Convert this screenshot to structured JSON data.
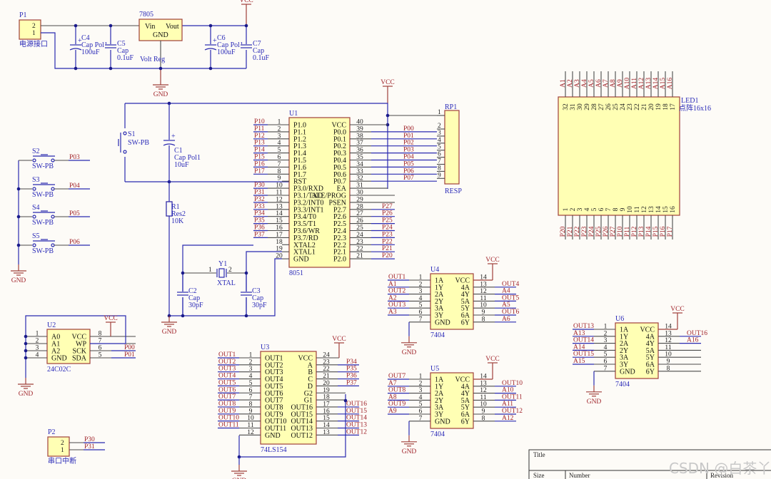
{
  "power": {
    "vcc": "VCC",
    "gnd": "GND"
  },
  "p1": {
    "ref": "P1",
    "desc": "电源接口",
    "pins": [
      "2",
      "1"
    ]
  },
  "p2": {
    "ref": "P2",
    "desc": "串口中断",
    "pins": [
      "2",
      "1"
    ],
    "nets": [
      "P30",
      "P31"
    ]
  },
  "reg": {
    "part": "7805",
    "vin": "Vin",
    "vout": "Vout",
    "gnd": "GND",
    "footer": "Volt Reg"
  },
  "passives": {
    "c4": {
      "ref": "C4",
      "type": "Cap Pol1",
      "value": "100uF"
    },
    "c5": {
      "ref": "C5",
      "type": "Cap",
      "value": "0.1uF"
    },
    "c6": {
      "ref": "C6",
      "type": "Cap Pol1",
      "value": "100uF"
    },
    "c7": {
      "ref": "C7",
      "type": "Cap",
      "value": "0.1uF"
    },
    "c1": {
      "ref": "C1",
      "type": "Cap Pol1",
      "value": "10uF"
    },
    "c2": {
      "ref": "C2",
      "type": "Cap",
      "value": "30pF"
    },
    "c3": {
      "ref": "C3",
      "type": "Cap",
      "value": "30pF"
    },
    "r1": {
      "ref": "R1",
      "type": "Res2",
      "value": "10K"
    },
    "y1": {
      "ref": "Y1",
      "type": "XTAL",
      "pin1": "1",
      "pin2": "2"
    }
  },
  "switches": [
    {
      "ref": "S1",
      "type": "SW-PB",
      "net": ""
    },
    {
      "ref": "S2",
      "type": "SW-PB",
      "net": "P03"
    },
    {
      "ref": "S3",
      "type": "SW-PB",
      "net": "P04"
    },
    {
      "ref": "S4",
      "type": "SW-PB",
      "net": "P05"
    },
    {
      "ref": "S5",
      "type": "SW-PB",
      "net": "P06"
    }
  ],
  "u1": {
    "ref": "U1",
    "part": "8051",
    "left": [
      {
        "n": "1",
        "name": "P1.0",
        "net": "P10"
      },
      {
        "n": "2",
        "name": "P1.1",
        "net": "P11"
      },
      {
        "n": "3",
        "name": "P1.2",
        "net": "P12"
      },
      {
        "n": "4",
        "name": "P1.3",
        "net": "P13"
      },
      {
        "n": "5",
        "name": "P1.4",
        "net": "P14"
      },
      {
        "n": "6",
        "name": "P1.5",
        "net": "P15"
      },
      {
        "n": "7",
        "name": "P1.6",
        "net": "P16"
      },
      {
        "n": "8",
        "name": "P1.7",
        "net": "P17"
      },
      {
        "n": "9",
        "name": "RST",
        "net": ""
      },
      {
        "n": "10",
        "name": "P3.0/RXD",
        "net": "P30"
      },
      {
        "n": "11",
        "name": "P3.1/TXD",
        "net": "P31"
      },
      {
        "n": "12",
        "name": "P3.2/INT0",
        "net": "P32"
      },
      {
        "n": "13",
        "name": "P3.3/INT1",
        "net": "P33"
      },
      {
        "n": "14",
        "name": "P3.4/T0",
        "net": "P34"
      },
      {
        "n": "15",
        "name": "P3.5/T1",
        "net": "P35"
      },
      {
        "n": "16",
        "name": "P3.6/WR",
        "net": "P36"
      },
      {
        "n": "17",
        "name": "P3.7/RD",
        "net": "P37"
      },
      {
        "n": "18",
        "name": "XTAL2",
        "net": ""
      },
      {
        "n": "19",
        "name": "XTAL1",
        "net": ""
      },
      {
        "n": "20",
        "name": "GND",
        "net": ""
      }
    ],
    "right": [
      {
        "n": "40",
        "name": "VCC",
        "net": ""
      },
      {
        "n": "39",
        "name": "P0.0",
        "net": "P00"
      },
      {
        "n": "38",
        "name": "P0.1",
        "net": "P01"
      },
      {
        "n": "37",
        "name": "P0.2",
        "net": "P02"
      },
      {
        "n": "36",
        "name": "P0.3",
        "net": "P03"
      },
      {
        "n": "35",
        "name": "P0.4",
        "net": "P04"
      },
      {
        "n": "34",
        "name": "P0.5",
        "net": "P05"
      },
      {
        "n": "33",
        "name": "P0.6",
        "net": "P06"
      },
      {
        "n": "32",
        "name": "P0.7",
        "net": "P07"
      },
      {
        "n": "31",
        "name": "EA",
        "net": ""
      },
      {
        "n": "30",
        "name": "ALE/PROG",
        "net": ""
      },
      {
        "n": "29",
        "name": "PSEN",
        "net": ""
      },
      {
        "n": "28",
        "name": "P2.7",
        "net": "P27"
      },
      {
        "n": "27",
        "name": "P2.6",
        "net": "P26"
      },
      {
        "n": "26",
        "name": "P2.5",
        "net": "P25"
      },
      {
        "n": "25",
        "name": "P2.4",
        "net": "P24"
      },
      {
        "n": "24",
        "name": "P2.3",
        "net": "P23"
      },
      {
        "n": "23",
        "name": "P2.2",
        "net": "P22"
      },
      {
        "n": "22",
        "name": "P2.1",
        "net": "P21"
      },
      {
        "n": "21",
        "name": "P2.0",
        "net": "P20"
      }
    ]
  },
  "rp1": {
    "ref": "RP1",
    "part": "RESP",
    "pins": [
      "1",
      "2",
      "3",
      "4",
      "5",
      "6",
      "7",
      "8",
      "9"
    ]
  },
  "u2": {
    "ref": "U2",
    "part": "24C02C",
    "left": [
      {
        "n": "1",
        "name": "A0",
        "net": ""
      },
      {
        "n": "2",
        "name": "A1",
        "net": ""
      },
      {
        "n": "3",
        "name": "A2",
        "net": ""
      },
      {
        "n": "4",
        "name": "GND",
        "net": ""
      }
    ],
    "right": [
      {
        "n": "8",
        "name": "VCC",
        "net": ""
      },
      {
        "n": "7",
        "name": "WP",
        "net": ""
      },
      {
        "n": "6",
        "name": "SCK",
        "net": "P00"
      },
      {
        "n": "5",
        "name": "SDA",
        "net": "P01"
      }
    ]
  },
  "u3": {
    "ref": "U3",
    "part": "74LS154",
    "left": [
      {
        "n": "1",
        "name": "OUT1",
        "net": "OUT1"
      },
      {
        "n": "2",
        "name": "OUT2",
        "net": "OUT2"
      },
      {
        "n": "3",
        "name": "OUT3",
        "net": "OUT3"
      },
      {
        "n": "4",
        "name": "OUT4",
        "net": "OUT4"
      },
      {
        "n": "5",
        "name": "OUT5",
        "net": "OUT5"
      },
      {
        "n": "6",
        "name": "OUT6",
        "net": "OUT6"
      },
      {
        "n": "7",
        "name": "OUT7",
        "net": "OUT7"
      },
      {
        "n": "8",
        "name": "OUT8",
        "net": "OUT8"
      },
      {
        "n": "9",
        "name": "OUT9",
        "net": "OUT9"
      },
      {
        "n": "10",
        "name": "OUT10",
        "net": "OUT10"
      },
      {
        "n": "11",
        "name": "OUT11",
        "net": "OUT11"
      },
      {
        "n": "12",
        "name": "GND",
        "net": ""
      }
    ],
    "right": [
      {
        "n": "24",
        "name": "VCC",
        "net": ""
      },
      {
        "n": "23",
        "name": "A",
        "net": "P34"
      },
      {
        "n": "22",
        "name": "B",
        "net": "P35"
      },
      {
        "n": "21",
        "name": "C",
        "net": "P36"
      },
      {
        "n": "20",
        "name": "D",
        "net": "P37"
      },
      {
        "n": "19",
        "name": "G2",
        "net": ""
      },
      {
        "n": "18",
        "name": "G1",
        "net": ""
      },
      {
        "n": "17",
        "name": "OUT16",
        "net": "OUT16"
      },
      {
        "n": "16",
        "name": "OUT15",
        "net": "OUT15"
      },
      {
        "n": "15",
        "name": "OUT14",
        "net": "OUT14"
      },
      {
        "n": "14",
        "name": "OUT13",
        "net": "OUT13"
      },
      {
        "n": "13",
        "name": "OUT12",
        "net": "OUT12"
      }
    ]
  },
  "u4": {
    "ref": "U4",
    "part": "7404",
    "left": [
      {
        "n": "1",
        "name": "1A",
        "net": "OUT1"
      },
      {
        "n": "2",
        "name": "1Y",
        "net": "A1"
      },
      {
        "n": "3",
        "name": "2A",
        "net": "OUT2"
      },
      {
        "n": "4",
        "name": "2Y",
        "net": "A2"
      },
      {
        "n": "5",
        "name": "3A",
        "net": "OUT3"
      },
      {
        "n": "6",
        "name": "3Y",
        "net": "A3"
      },
      {
        "n": "7",
        "name": "GND",
        "net": ""
      }
    ],
    "right": [
      {
        "n": "14",
        "name": "VCC",
        "net": ""
      },
      {
        "n": "13",
        "name": "4A",
        "net": "OUT4"
      },
      {
        "n": "12",
        "name": "4Y",
        "net": "A4"
      },
      {
        "n": "11",
        "name": "5A",
        "net": "OUT5"
      },
      {
        "n": "10",
        "name": "5Y",
        "net": "A5"
      },
      {
        "n": "9",
        "name": "6A",
        "net": "OUT6"
      },
      {
        "n": "8",
        "name": "6Y",
        "net": "A6"
      }
    ]
  },
  "u5": {
    "ref": "U5",
    "part": "7404",
    "left": [
      {
        "n": "1",
        "name": "1A",
        "net": "OUT7"
      },
      {
        "n": "2",
        "name": "1Y",
        "net": "A7"
      },
      {
        "n": "3",
        "name": "2A",
        "net": "OUT8"
      },
      {
        "n": "4",
        "name": "2Y",
        "net": "A8"
      },
      {
        "n": "5",
        "name": "3A",
        "net": "OUT9"
      },
      {
        "n": "6",
        "name": "3Y",
        "net": "A9"
      },
      {
        "n": "7",
        "name": "GND",
        "net": ""
      }
    ],
    "right": [
      {
        "n": "14",
        "name": "VCC",
        "net": ""
      },
      {
        "n": "13",
        "name": "4A",
        "net": "OUT10"
      },
      {
        "n": "12",
        "name": "4Y",
        "net": "A10"
      },
      {
        "n": "11",
        "name": "5A",
        "net": "OUT11"
      },
      {
        "n": "10",
        "name": "5Y",
        "net": "A11"
      },
      {
        "n": "9",
        "name": "6A",
        "net": "OUT12"
      },
      {
        "n": "8",
        "name": "6Y",
        "net": "A12"
      }
    ]
  },
  "u6": {
    "ref": "U6",
    "part": "7404",
    "left": [
      {
        "n": "1",
        "name": "1A",
        "net": "OUT13"
      },
      {
        "n": "2",
        "name": "1Y",
        "net": "A13"
      },
      {
        "n": "3",
        "name": "2A",
        "net": "OUT14"
      },
      {
        "n": "4",
        "name": "2Y",
        "net": "A14"
      },
      {
        "n": "5",
        "name": "3A",
        "net": "OUT15"
      },
      {
        "n": "6",
        "name": "3Y",
        "net": "A15"
      },
      {
        "n": "7",
        "name": "GND",
        "net": ""
      }
    ],
    "right": [
      {
        "n": "14",
        "name": "VCC",
        "net": ""
      },
      {
        "n": "13",
        "name": "4A",
        "net": "OUT16"
      },
      {
        "n": "12",
        "name": "4Y",
        "net": "A16"
      },
      {
        "n": "11",
        "name": "5A",
        "net": ""
      },
      {
        "n": "10",
        "name": "5Y",
        "net": ""
      },
      {
        "n": "9",
        "name": "6A",
        "net": ""
      },
      {
        "n": "8",
        "name": "6Y",
        "net": ""
      }
    ]
  },
  "led1": {
    "ref": "LED1",
    "part": "点阵16x16",
    "top": [
      {
        "n": "32",
        "net": "A1"
      },
      {
        "n": "31",
        "net": "A2"
      },
      {
        "n": "30",
        "net": "A3"
      },
      {
        "n": "29",
        "net": "A4"
      },
      {
        "n": "28",
        "net": "A5"
      },
      {
        "n": "27",
        "net": "A6"
      },
      {
        "n": "26",
        "net": "A7"
      },
      {
        "n": "25",
        "net": "A8"
      },
      {
        "n": "24",
        "net": "A9"
      },
      {
        "n": "23",
        "net": "A10"
      },
      {
        "n": "22",
        "net": "A11"
      },
      {
        "n": "21",
        "net": "A12"
      },
      {
        "n": "20",
        "net": "A13"
      },
      {
        "n": "19",
        "net": "A14"
      },
      {
        "n": "18",
        "net": "A15"
      },
      {
        "n": "17",
        "net": "A16"
      }
    ],
    "bottom": [
      {
        "n": "1",
        "net": "P20"
      },
      {
        "n": "2",
        "net": "P21"
      },
      {
        "n": "3",
        "net": "P22"
      },
      {
        "n": "4",
        "net": "P23"
      },
      {
        "n": "5",
        "net": "P24"
      },
      {
        "n": "6",
        "net": "P25"
      },
      {
        "n": "7",
        "net": "P26"
      },
      {
        "n": "8",
        "net": "P27"
      },
      {
        "n": "9",
        "net": "P10"
      },
      {
        "n": "10",
        "net": "P11"
      },
      {
        "n": "11",
        "net": "P12"
      },
      {
        "n": "12",
        "net": "P13"
      },
      {
        "n": "13",
        "net": "P14"
      },
      {
        "n": "14",
        "net": "P15"
      },
      {
        "n": "15",
        "net": "P16"
      },
      {
        "n": "16",
        "net": "P17"
      }
    ]
  },
  "title_block": {
    "title": "Title",
    "size": "Size",
    "number": "Number",
    "revision": "Revision"
  },
  "watermark": "CSDN @白茶丫",
  "colors": {
    "wire": "#2a2ab0",
    "component_fill": "#ffffb4",
    "component_border": "#a0403a",
    "net_label": "#a0232a",
    "designator": "#2b2bb8"
  }
}
